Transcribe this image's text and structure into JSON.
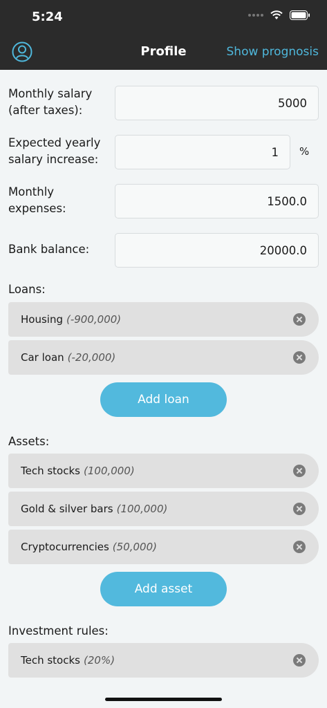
{
  "status_bar": {
    "time": "5:24"
  },
  "nav": {
    "title": "Profile",
    "action_label": "Show prognosis"
  },
  "fields": {
    "salary": {
      "label_line1": "Monthly salary",
      "label_line2": "(after taxes):",
      "value": "5000"
    },
    "increase": {
      "label_line1": "Expected yearly",
      "label_line2": "salary increase:",
      "value": "1",
      "unit": "%"
    },
    "expenses": {
      "label_line1": "Monthly",
      "label_line2": "expenses:",
      "value": "1500.0"
    },
    "balance": {
      "label": "Bank balance:",
      "value": "20000.0"
    }
  },
  "loans": {
    "title": "Loans:",
    "items": [
      {
        "name": "Housing",
        "amount": "(-900,000)"
      },
      {
        "name": "Car loan",
        "amount": "(-20,000)"
      }
    ],
    "add_label": "Add loan"
  },
  "assets": {
    "title": "Assets:",
    "items": [
      {
        "name": "Tech stocks",
        "amount": "(100,000)"
      },
      {
        "name": "Gold & silver bars",
        "amount": "(100,000)"
      },
      {
        "name": "Cryptocurrencies",
        "amount": "(50,000)"
      }
    ],
    "add_label": "Add asset"
  },
  "investment_rules": {
    "title": "Investment rules:",
    "items": [
      {
        "name": "Tech stocks",
        "amount": "(20%)"
      }
    ]
  },
  "colors": {
    "accent": "#52b9dd",
    "nav_bg": "#2b2b2b",
    "pill_bg": "#e0e0e0",
    "page_bg": "#f2f5f6"
  }
}
